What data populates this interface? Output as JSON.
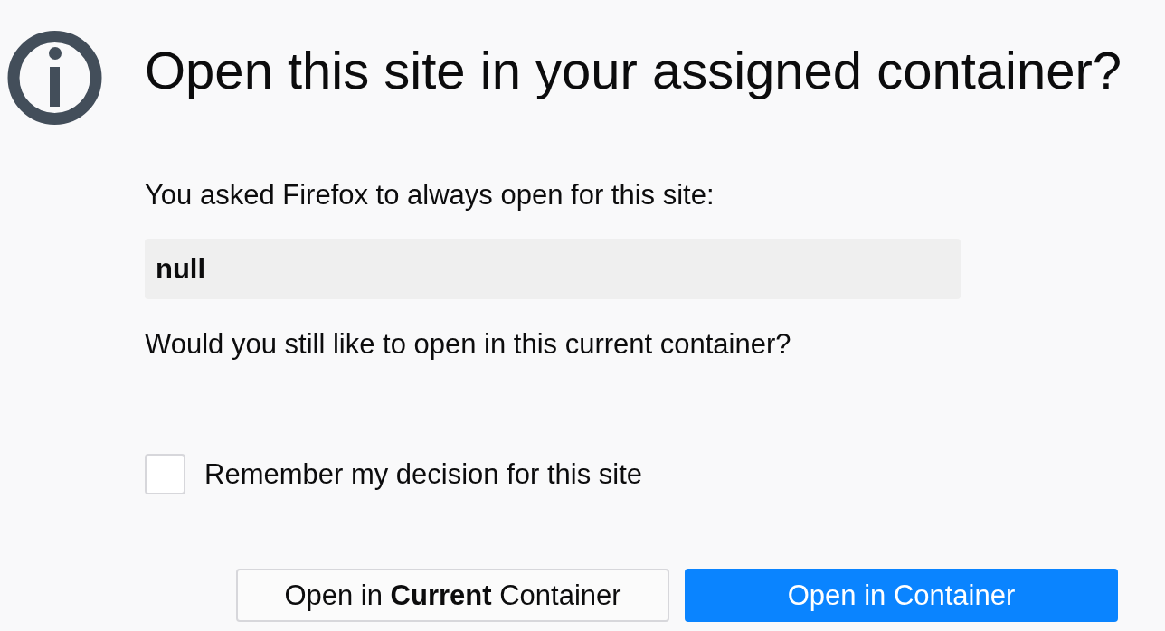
{
  "dialog": {
    "title": "Open this site in your assigned container?",
    "message": "You asked Firefox to always open for this site:",
    "site": "null",
    "question": "Would you still like to open in this current container?",
    "remember": {
      "label": "Remember my decision for this site",
      "checked": false
    },
    "buttons": [
      {
        "label": "Open in **Current** Container",
        "kind": "secondary"
      },
      {
        "label": "Open in Container",
        "kind": "primary"
      }
    ]
  }
}
